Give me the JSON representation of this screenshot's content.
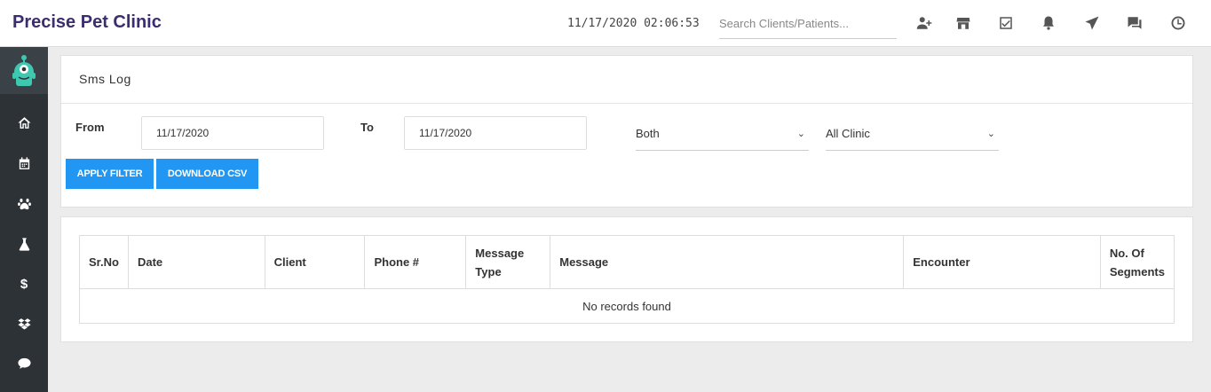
{
  "header": {
    "clinic_name": "Precise Pet Clinic",
    "datetime": "11/17/2020 02:06:53",
    "search_placeholder": "Search Clients/Patients...",
    "icons": [
      "add-user-icon",
      "store-icon",
      "checkbox-icon",
      "bell-icon",
      "send-icon",
      "chat-icon",
      "clock-icon"
    ]
  },
  "sidebar": {
    "items": [
      "home-icon",
      "calendar-icon",
      "paw-icon",
      "flask-icon",
      "dollar-icon",
      "dropbox-icon",
      "comment-icon"
    ],
    "dollar_glyph": "$"
  },
  "filter_panel": {
    "title": "Sms Log",
    "from_label": "From",
    "from_value": "11/17/2020",
    "to_label": "To",
    "to_value": "11/17/2020",
    "type_select": "Both",
    "clinic_select": "All Clinic",
    "apply_label": "APPLY FILTER",
    "download_label": "DOWNLOAD CSV"
  },
  "table": {
    "columns": [
      "Sr.No",
      "Date",
      "Client",
      "Phone #",
      "Message Type",
      "Message",
      "Encounter",
      "No. Of Segments"
    ],
    "empty_message": "No records found"
  },
  "colors": {
    "brand": "#3b2e6e",
    "sidebar": "#2c3236",
    "button": "#2196f3",
    "logo_accent": "#3fc8b0"
  }
}
